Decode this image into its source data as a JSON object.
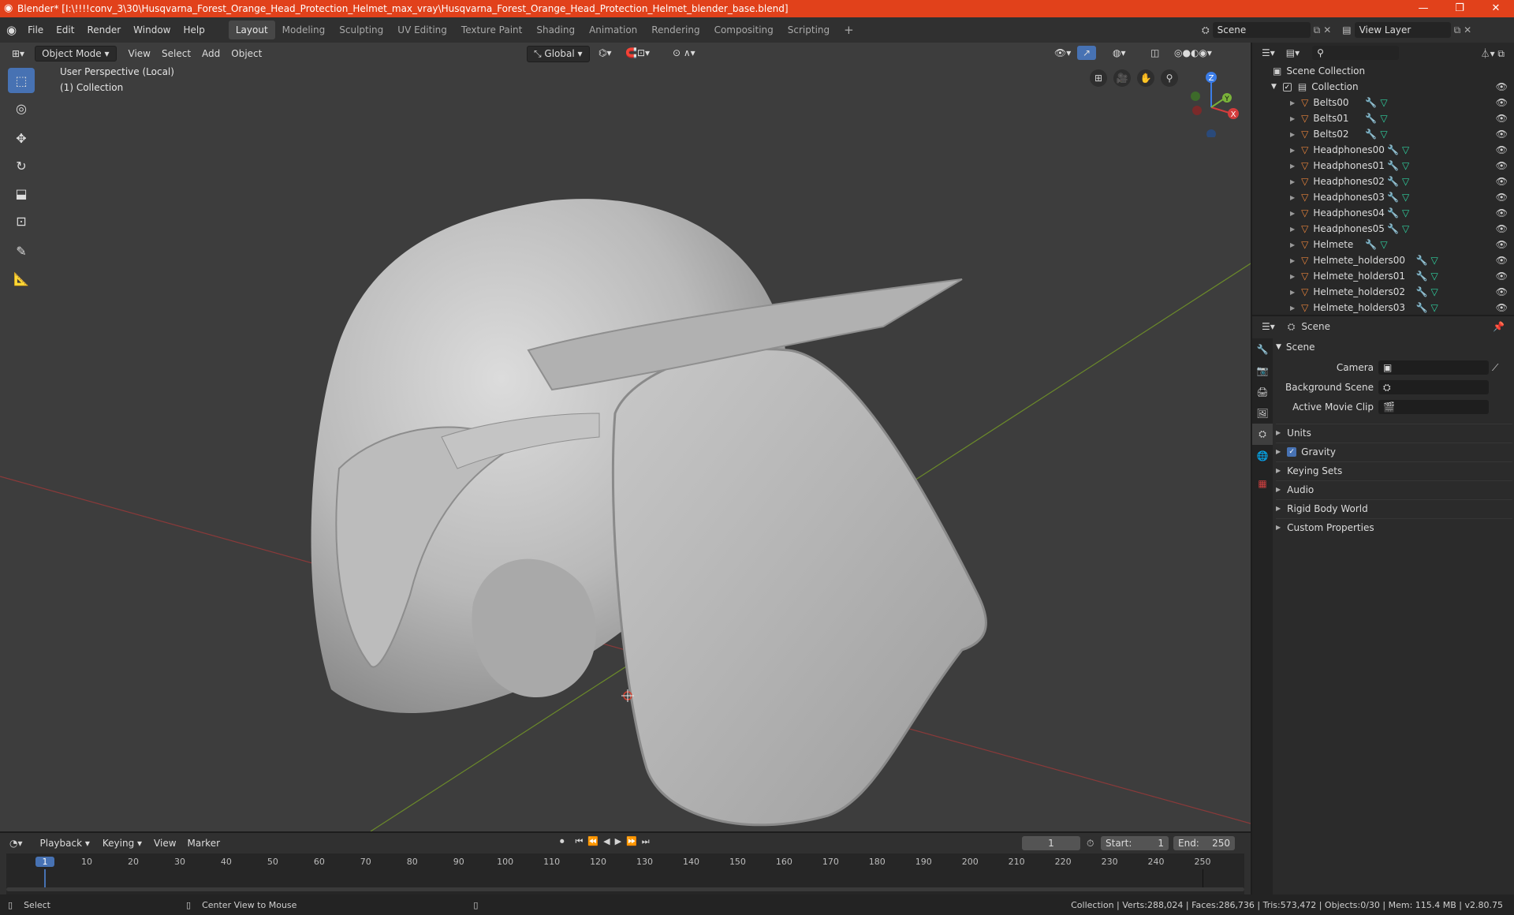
{
  "titlebar": {
    "title": "Blender* [I:\\!!!!conv_3\\30\\Husqvarna_Forest_Orange_Head_Protection_Helmet_max_vray\\Husqvarna_Forest_Orange_Head_Protection_Helmet_blender_base.blend]",
    "minimize": "—",
    "restore": "❐",
    "close": "✕"
  },
  "menu": {
    "items": [
      "File",
      "Edit",
      "Render",
      "Window",
      "Help"
    ]
  },
  "workspaces": {
    "tabs": [
      "Layout",
      "Modeling",
      "Sculpting",
      "UV Editing",
      "Texture Paint",
      "Shading",
      "Animation",
      "Rendering",
      "Compositing",
      "Scripting"
    ],
    "active": "Layout",
    "add": "+"
  },
  "scene_selector": {
    "value": "Scene"
  },
  "viewlayer_selector": {
    "value": "View Layer"
  },
  "viewport": {
    "mode": "Object Mode",
    "menus": [
      "View",
      "Select",
      "Add",
      "Object"
    ],
    "orientation": "Global",
    "overlay_line1": "User Perspective (Local)",
    "overlay_line2": "(1) Collection",
    "gizmo": {
      "x": "X",
      "y": "Y",
      "z": "Z"
    }
  },
  "outliner": {
    "search_placeholder": "",
    "root": "Scene Collection",
    "collection": "Collection",
    "items": [
      "Belts00",
      "Belts01",
      "Belts02",
      "Headphones00",
      "Headphones01",
      "Headphones02",
      "Headphones03",
      "Headphones04",
      "Headphones05",
      "Helmete",
      "Helmete_holders00",
      "Helmete_holders01",
      "Helmete_holders02",
      "Helmete_holders03"
    ]
  },
  "properties": {
    "context": "Scene",
    "panel_title": "Scene",
    "camera_label": "Camera",
    "bg_scene_label": "Background Scene",
    "movie_clip_label": "Active Movie Clip",
    "sections": [
      "Units",
      "Gravity",
      "Keying Sets",
      "Audio",
      "Rigid Body World",
      "Custom Properties"
    ],
    "gravity_checked": true
  },
  "timeline": {
    "menus": [
      "Playback",
      "Keying",
      "View",
      "Marker"
    ],
    "current_frame": "1",
    "start_label": "Start:",
    "start": "1",
    "end_label": "End:",
    "end": "250",
    "ticks": [
      "1",
      "10",
      "20",
      "30",
      "40",
      "50",
      "60",
      "70",
      "80",
      "90",
      "100",
      "110",
      "120",
      "130",
      "140",
      "150",
      "160",
      "170",
      "180",
      "190",
      "200",
      "210",
      "220",
      "230",
      "240",
      "250"
    ]
  },
  "statusbar": {
    "left": "Select",
    "middle": "Center View to Mouse",
    "right": "Collection | Verts:288,024 | Faces:286,736 | Tris:573,472 | Objects:0/30 | Mem: 115.4 MB | v2.80.75"
  },
  "colors": {
    "titlebar": "#e1411b",
    "accent": "#4772b3",
    "mesh_icon": "#e8843c",
    "modifier_icon": "#5a9ee8",
    "data_icon": "#2fd1a0"
  }
}
